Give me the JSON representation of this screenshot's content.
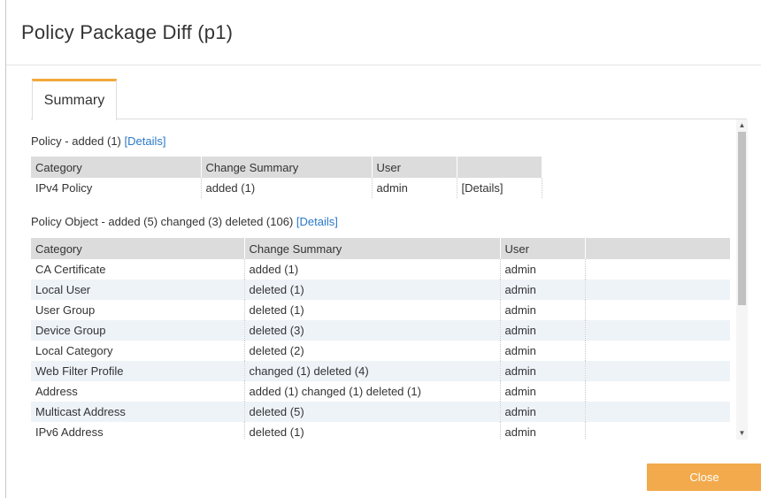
{
  "dialog": {
    "title": "Policy Package Diff (p1)",
    "tabs": [
      {
        "label": "Summary",
        "active": true
      }
    ],
    "close_label": "Close"
  },
  "policy": {
    "heading": "Policy - added (1)",
    "details_link": "[Details]",
    "columns": [
      "Category",
      "Change Summary",
      "User",
      ""
    ],
    "rows": [
      {
        "category": "IPv4 Policy",
        "summary": "added (1)",
        "user": "admin",
        "details": "[Details]"
      }
    ]
  },
  "policy_object": {
    "heading": "Policy Object - added (5) changed (3) deleted (106)",
    "details_link": "[Details]",
    "columns": [
      "Category",
      "Change Summary",
      "User",
      ""
    ],
    "rows": [
      {
        "category": "CA Certificate",
        "summary": "added (1)",
        "user": "admin"
      },
      {
        "category": "Local User",
        "summary": "deleted (1)",
        "user": "admin"
      },
      {
        "category": "User Group",
        "summary": "deleted (1)",
        "user": "admin"
      },
      {
        "category": "Device Group",
        "summary": "deleted (3)",
        "user": "admin"
      },
      {
        "category": "Local Category",
        "summary": "deleted (2)",
        "user": "admin"
      },
      {
        "category": "Web Filter Profile",
        "summary": "changed (1) deleted (4)",
        "user": "admin"
      },
      {
        "category": "Address",
        "summary": "added (1) changed (1) deleted (1)",
        "user": "admin"
      },
      {
        "category": "Multicast Address",
        "summary": "deleted (5)",
        "user": "admin"
      },
      {
        "category": "IPv6 Address",
        "summary": "deleted (1)",
        "user": "admin"
      }
    ]
  },
  "colors": {
    "accent": "#f2aa4c",
    "link": "#2a78c8",
    "header_bg": "#dcdcdc",
    "row_alt": "#eef3f8"
  },
  "icons": {
    "scroll_up": "triangle-up-icon",
    "scroll_down": "triangle-down-icon"
  }
}
